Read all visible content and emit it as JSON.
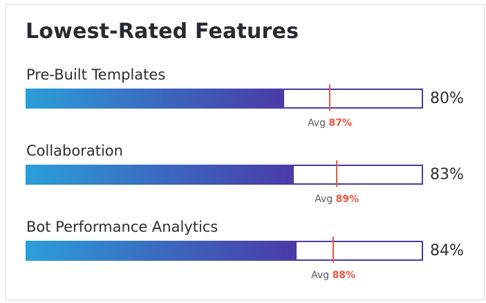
{
  "title": "Lowest-Rated Features",
  "avg_label": "Avg",
  "colors": {
    "bar_start": "#2a9fd9",
    "bar_end": "#4a3aa8",
    "bar_border": "#4b39a6",
    "avg_marker": "#ef553b"
  },
  "features": [
    {
      "label": "Pre-Built Templates",
      "value": 80,
      "value_text": "80%",
      "avg": 87,
      "avg_text": "87%"
    },
    {
      "label": "Collaboration",
      "value": 83,
      "value_text": "83%",
      "avg": 89,
      "avg_text": "89%"
    },
    {
      "label": "Bot Performance Analytics",
      "value": 84,
      "value_text": "84%",
      "avg": 88,
      "avg_text": "88%"
    }
  ]
}
